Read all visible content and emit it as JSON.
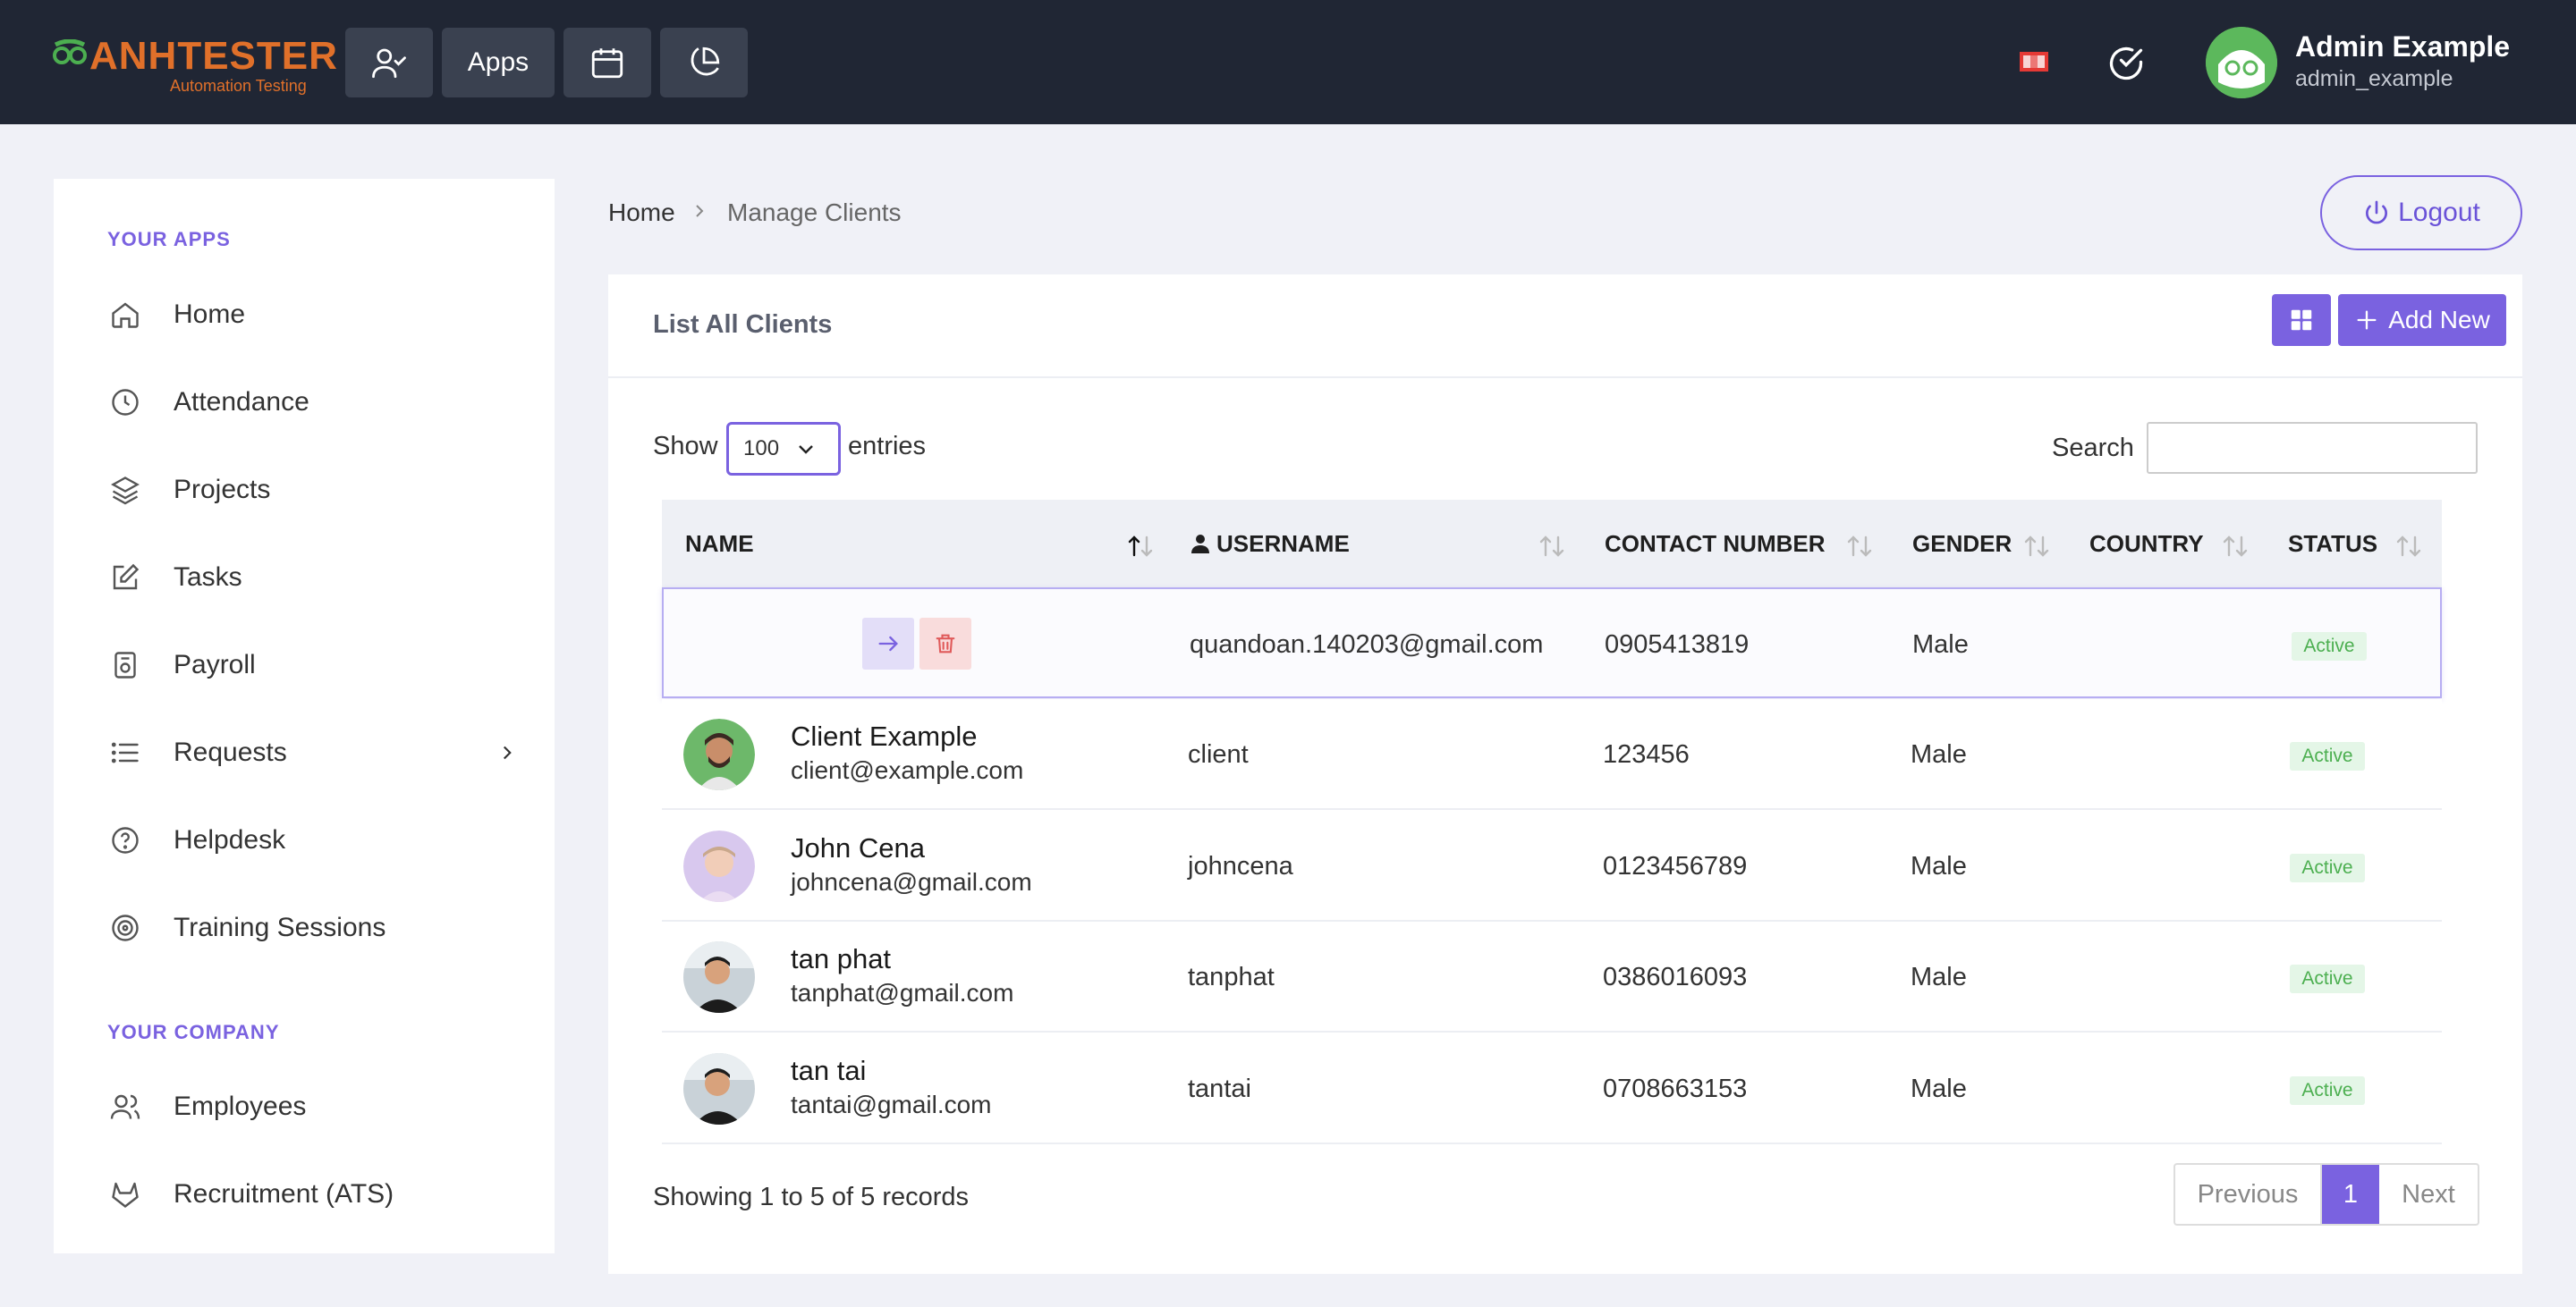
{
  "header": {
    "brand": "ANHTESTER",
    "tagline": "Automation Testing",
    "apps_label": "Apps",
    "user_name": "Admin Example",
    "user_handle": "admin_example"
  },
  "sidebar": {
    "section_apps": "YOUR APPS",
    "items": [
      {
        "label": "Home",
        "icon": "home-icon"
      },
      {
        "label": "Attendance",
        "icon": "clock-icon"
      },
      {
        "label": "Projects",
        "icon": "layers-icon"
      },
      {
        "label": "Tasks",
        "icon": "edit-icon"
      },
      {
        "label": "Payroll",
        "icon": "safe-icon"
      },
      {
        "label": "Requests",
        "icon": "list-icon"
      },
      {
        "label": "Helpdesk",
        "icon": "help-icon"
      },
      {
        "label": "Training Sessions",
        "icon": "target-icon"
      }
    ],
    "section_company": "YOUR COMPANY",
    "company_items": [
      {
        "label": "Employees",
        "icon": "users-icon"
      },
      {
        "label": "Recruitment (ATS)",
        "icon": "gitlab-icon"
      }
    ]
  },
  "breadcrumb": {
    "home": "Home",
    "current": "Manage Clients"
  },
  "logout_label": "Logout",
  "card": {
    "title": "List All Clients",
    "add_label": "Add New",
    "show_label": "Show",
    "entries_value": "100",
    "entries_label": "entries",
    "search_label": "Search",
    "search_value": ""
  },
  "table": {
    "columns": [
      "NAME",
      "USERNAME",
      "CONTACT NUMBER",
      "GENDER",
      "COUNTRY",
      "STATUS"
    ],
    "rows": [
      {
        "name": "",
        "email": "",
        "username": "quandoan.140203@gmail.com",
        "contact": "0905413819",
        "gender": "Male",
        "country": "",
        "status": "Active"
      },
      {
        "name": "Client Example",
        "email": "client@example.com",
        "username": "client",
        "contact": "123456",
        "gender": "Male",
        "country": "",
        "status": "Active"
      },
      {
        "name": "John Cena",
        "email": "johncena@gmail.com",
        "username": "johncena",
        "contact": "0123456789",
        "gender": "Male",
        "country": "",
        "status": "Active"
      },
      {
        "name": "tan phat",
        "email": "tanphat@gmail.com",
        "username": "tanphat",
        "contact": "0386016093",
        "gender": "Male",
        "country": "",
        "status": "Active"
      },
      {
        "name": "tan tai",
        "email": "tantai@gmail.com",
        "username": "tantai",
        "contact": "0708663153",
        "gender": "Male",
        "country": "",
        "status": "Active"
      }
    ]
  },
  "footer": {
    "showing": "Showing 1 to 5 of 5 records",
    "prev": "Previous",
    "page": "1",
    "next": "Next"
  },
  "colors": {
    "accent": "#7a62e0",
    "topbar": "#202634",
    "brand": "#e0702a",
    "active_bg": "#e4f6e7",
    "active_text": "#4caf50"
  }
}
